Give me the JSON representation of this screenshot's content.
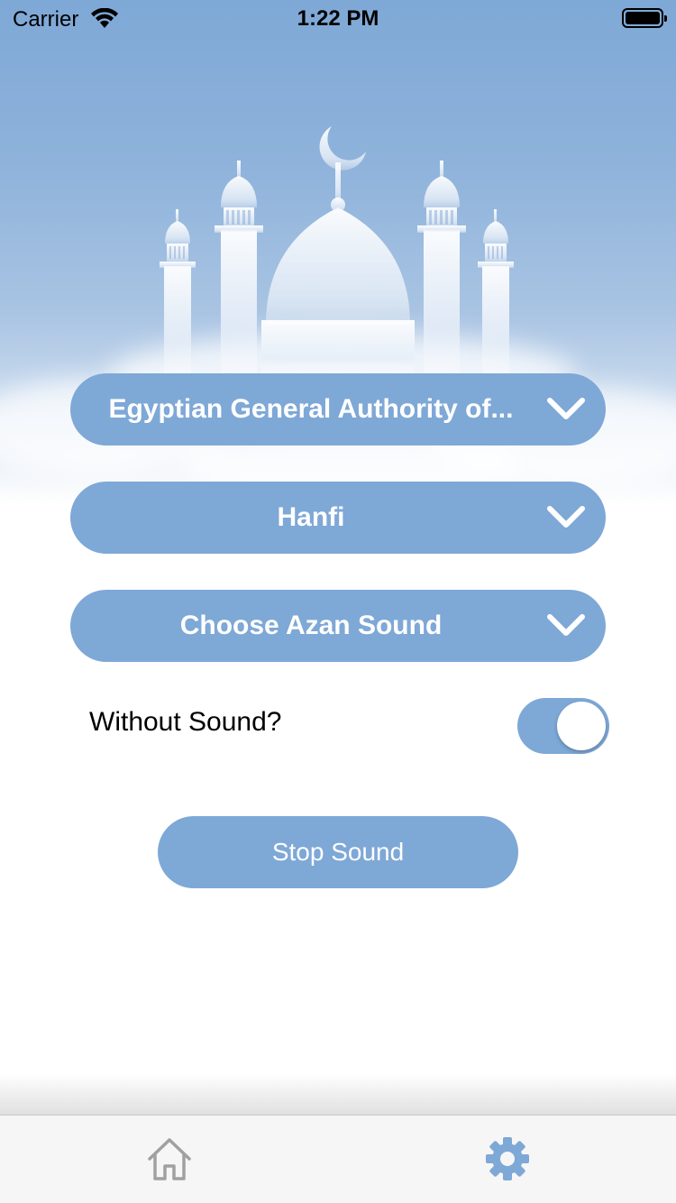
{
  "status_bar": {
    "carrier": "Carrier",
    "time": "1:22 PM"
  },
  "settings": {
    "calculation_method": "Egyptian General Authority of...",
    "juristic_method": "Hanfi",
    "azan_sound": "Choose Azan Sound",
    "without_sound_label": "Without Sound?",
    "without_sound_enabled": true,
    "stop_sound_label": "Stop Sound"
  },
  "tab_bar": {
    "items": [
      {
        "icon": "home-icon",
        "selected": false
      },
      {
        "icon": "gear-icon",
        "selected": true
      }
    ]
  },
  "colors": {
    "accent": "#7ea8d6",
    "tab_inactive": "#a0a0a0",
    "tab_active": "#7ea8d6"
  }
}
